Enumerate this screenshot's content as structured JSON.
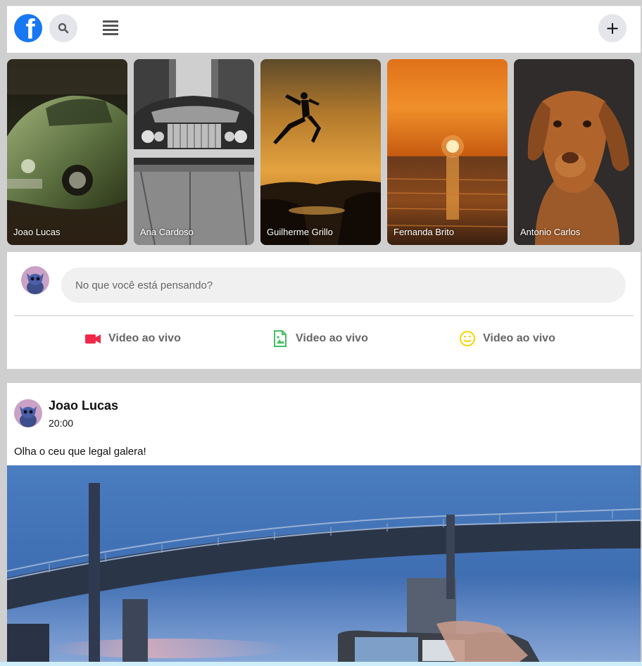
{
  "nav": {
    "logo_glyph": "f",
    "search_icon": "search-icon",
    "menu_icon": "hamburger-icon",
    "create_label": "+"
  },
  "stories": [
    {
      "name": "Joao Lucas",
      "scene": "green-vintage-car"
    },
    {
      "name": "Ana Cardoso",
      "scene": "vintage-car-alley"
    },
    {
      "name": "Guilherme Grillo",
      "scene": "jumping-silhouette-sunset"
    },
    {
      "name": "Fernanda Brito",
      "scene": "ocean-sunset"
    },
    {
      "name": "Antonio Carlos",
      "scene": "brown-dog-portrait"
    }
  ],
  "composer": {
    "placeholder": "No que você está pensando?",
    "actions": [
      {
        "label": "Video ao vivo",
        "icon": "video-camera-icon",
        "color": "#f02849"
      },
      {
        "label": "Video ao vivo",
        "icon": "photo-file-icon",
        "color": "#45bd62"
      },
      {
        "label": "Video ao vivo",
        "icon": "smiley-icon",
        "color": "#f7d500"
      }
    ]
  },
  "post": {
    "author": "Joao Lucas",
    "time": "20:00",
    "text": "Olha o ceu que legal galera!",
    "image_scene": "bridge-evening-sky-phone"
  },
  "colors": {
    "brand": "#1877f2",
    "page_bg": "#cfcfcf"
  }
}
